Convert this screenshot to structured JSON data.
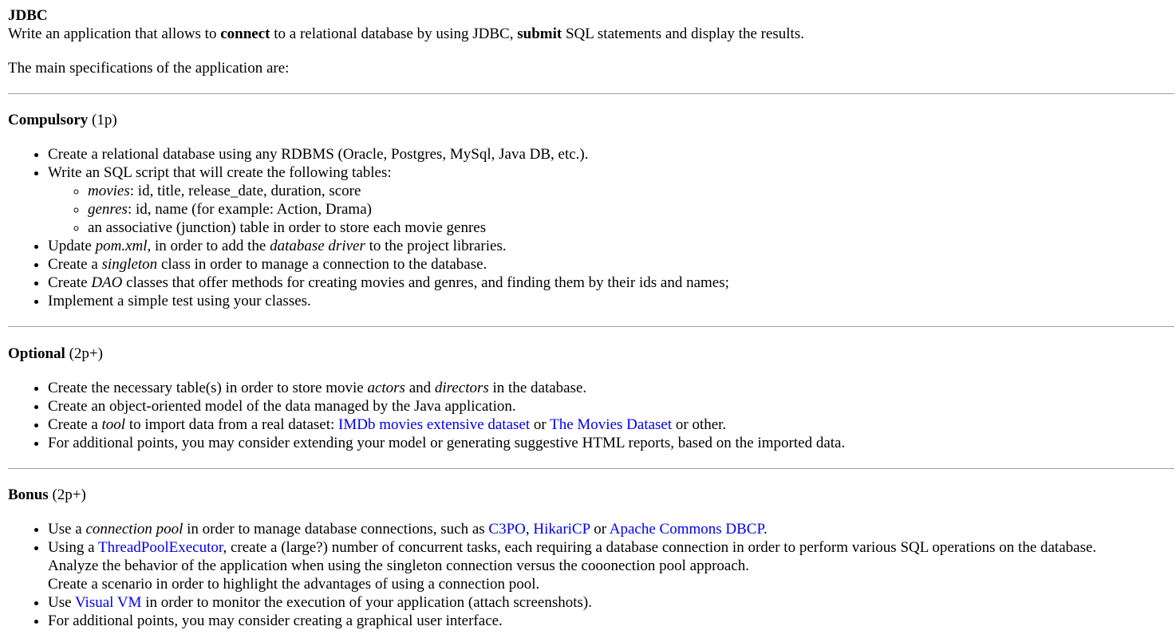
{
  "title": "JDBC",
  "intro": {
    "p1": [
      "Write an application that allows to ",
      "connect",
      " to a relational database by using JDBC, ",
      "submit",
      " SQL statements and display the results."
    ],
    "p2": "The main specifications of the application are:"
  },
  "compulsory": {
    "heading": "Compulsory",
    "points": " (1p)",
    "item1": "Create a relational database using any RDBMS (Oracle, Postgres, MySql, Java DB, etc.).",
    "item2": "Write an SQL script that will create the following tables:",
    "sub1": [
      "movies",
      ": id, title, release_date, duration, score"
    ],
    "sub2": [
      "genres",
      ": id, name (for example: Action, Drama)"
    ],
    "sub3": "an associative (junction) table in order to store each movie genres",
    "item3": [
      "Update ",
      "pom.xml",
      ", in order to add the ",
      "database driver",
      " to the project libraries."
    ],
    "item4": [
      "Create a ",
      "singleton",
      " class in order to manage a connection to the database."
    ],
    "item5": [
      "Create ",
      "DAO",
      " classes that offer methods for creating movies and genres, and finding them by their ids and names;"
    ],
    "item6": "Implement a simple test using your classes."
  },
  "optional": {
    "heading": "Optional",
    "points": " (2p+)",
    "item1": [
      "Create the necessary table(s) in order to store movie ",
      "actors",
      " and ",
      "directors",
      " in the database."
    ],
    "item2": "Create an object-oriented model of the data managed by the Java application.",
    "item3": [
      "Create a ",
      "tool",
      " to import data from a real dataset: ",
      "IMDb movies extensive dataset",
      " or ",
      "The Movies Dataset",
      " or other."
    ],
    "item4": "For additional points, you may consider extending your model or generating suggestive HTML reports, based on the imported data."
  },
  "bonus": {
    "heading": "Bonus",
    "points": " (2p+)",
    "item1": [
      "Use a ",
      "connection pool",
      " in order to manage database connections, such as ",
      "C3PO",
      ", ",
      "HikariCP",
      " or ",
      "Apache Commons DBCP",
      "."
    ],
    "item2": [
      "Using a ",
      "ThreadPoolExecutor",
      ", create a (large?) number of concurrent tasks, each requiring a database connection in order to perform various SQL operations on the database."
    ],
    "item2_line2": "Analyze the behavior of the application when using the singleton connection versus the cooonection pool approach.",
    "item2_line3": "Create a scenario in order to highlight the advantages of using a connection pool.",
    "item3": [
      "Use ",
      "Visual VM",
      " in order to monitor the execution of your application (attach screenshots)."
    ],
    "item4": "For additional points, you may consider creating a graphical user interface."
  },
  "colors": {
    "link": "#0000ee",
    "rule": "#a0a0a0"
  }
}
